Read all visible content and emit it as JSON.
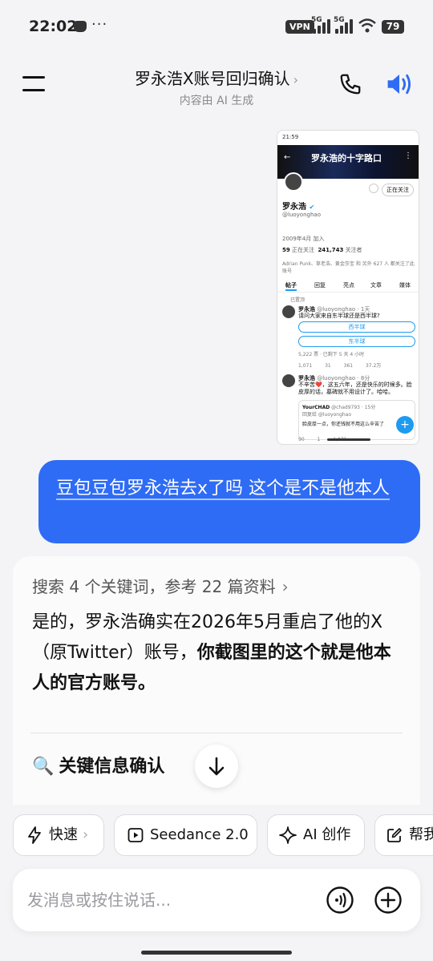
{
  "status_bar": {
    "time": "22:02",
    "dots": "···",
    "vpn": "VPN",
    "net1": "5G",
    "net2": "5G",
    "battery": "79"
  },
  "header": {
    "title": "罗永浩X账号回归确认",
    "title_chevron": "›",
    "subtitle": "内容由 AI 生成"
  },
  "thumbnail": {
    "status_time": "21:59",
    "banner_title": "罗永浩的十字路口",
    "follow_label": "正在关注",
    "name": "罗永浩",
    "handle": "@luoyonghao",
    "joined": "2009年4月 加入",
    "following_count": "59",
    "following_label": "正在关注",
    "followers_count": "241,743",
    "followers_label": "关注者",
    "followed_by": "Adrian Punk、草老浩、黄金莎宝 和 另外 627 人 都关注了此账号",
    "tabs": [
      "帖子",
      "回复",
      "亮点",
      "文章",
      "媒体"
    ],
    "pinned": "已置顶",
    "post1": {
      "name": "罗永浩",
      "meta": "@luoyonghao · 1天",
      "text": "请问大家来自东半球还是西半球?",
      "option1": "西半球",
      "option2": "东半球",
      "votes": "5,222 票 · 已剩下 5 天 4 小时",
      "actions": "1,071 31 361 37.2万"
    },
    "post2": {
      "name": "罗永浩",
      "meta": "@luoyonghao · 8分",
      "text": "不辛苦❤️，这五六年，还是快乐的时候多。脸皮厚的话，墓碑就不用设计了。哈哈。",
      "quote_user": "YourCHAD",
      "quote_meta": "@chad9793 · 15分",
      "quote_reply": "回复给 @luoyonghao",
      "quote_text": "脸皮厚一点，你还钱就不用这么辛苦了",
      "actions": "90 1 1,071"
    }
  },
  "user_message": {
    "text": "豆包豆包罗永浩去x了吗 这个是不是他本人"
  },
  "answer": {
    "search_summary": "搜索 4 个关键词，参考 22 篇资料",
    "search_chevron": "›",
    "text_plain": "是的，罗永浩确实在2026年5月重启了他的X（原Twitter）账号，",
    "text_bold": "你截图里的这个就是他本人的官方账号。",
    "key_heading": "关键信息确认",
    "key_icon": "🔍"
  },
  "chips": [
    {
      "label": "快速",
      "chevron": "›"
    },
    {
      "label": "Seedance 2.0"
    },
    {
      "label": "AI 创作"
    },
    {
      "label": "帮我"
    }
  ],
  "input": {
    "placeholder": "发消息或按住说话..."
  },
  "colors": {
    "accent": "#2f6cf5",
    "x_blue": "#1d9bf0"
  }
}
